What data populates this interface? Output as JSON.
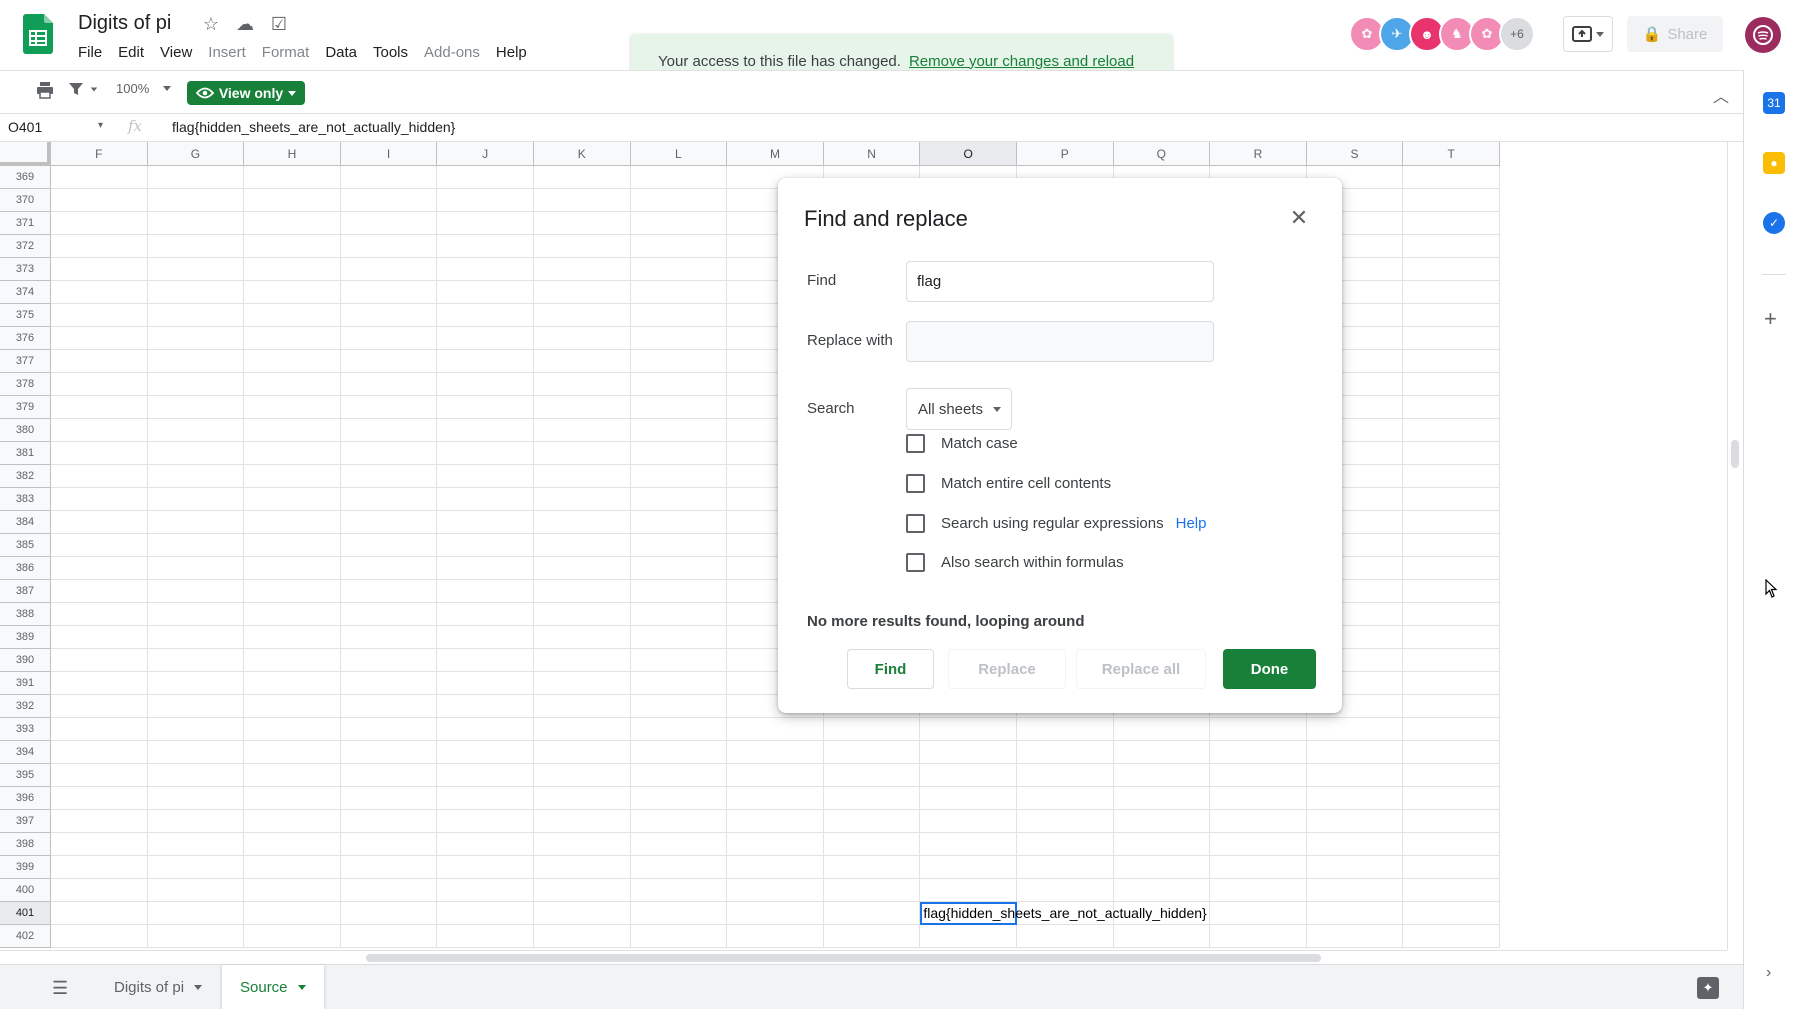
{
  "app": {
    "doc_title": "Digits of pi",
    "brand_color": "#188038",
    "menu": [
      {
        "label": "File",
        "disabled": false
      },
      {
        "label": "Edit",
        "disabled": false
      },
      {
        "label": "View",
        "disabled": false
      },
      {
        "label": "Insert",
        "disabled": true
      },
      {
        "label": "Format",
        "disabled": true
      },
      {
        "label": "Data",
        "disabled": false
      },
      {
        "label": "Tools",
        "disabled": false
      },
      {
        "label": "Add-ons",
        "disabled": true
      },
      {
        "label": "Help",
        "disabled": false
      }
    ],
    "collaborators_more": "+6",
    "collaborator_colors": [
      "#f28bb5",
      "#4ea6e8",
      "#e8336d",
      "#f28bb5",
      "#f28bb5"
    ],
    "share_label": "Share",
    "account_color": "#9c2b5e"
  },
  "toast": {
    "message": "Your access to this file has changed.",
    "link": "Remove your changes and reload"
  },
  "toolbar": {
    "zoom": "100%",
    "view_only_label": "View only"
  },
  "formula_bar": {
    "cell_ref": "O401",
    "formula": "flag{hidden_sheets_are_not_actually_hidden}"
  },
  "grid": {
    "columns": [
      "F",
      "G",
      "H",
      "I",
      "J",
      "K",
      "L",
      "M",
      "N",
      "O",
      "P",
      "Q",
      "R",
      "S",
      "T"
    ],
    "selected_column": "O",
    "row_start": 369,
    "row_end": 402,
    "selected_row": 401,
    "active_cell_text": "flag{hidden_sheets_are_not_actually_hidden}"
  },
  "sheets": {
    "tabs": [
      {
        "label": "Digits of pi",
        "active": false
      },
      {
        "label": "Source",
        "active": true
      }
    ]
  },
  "dialog": {
    "title": "Find and replace",
    "find_label": "Find",
    "find_value": "flag",
    "replace_label": "Replace with",
    "replace_value": "",
    "search_label": "Search",
    "search_scope": "All sheets",
    "options": [
      {
        "label": "Match case",
        "checked": false
      },
      {
        "label": "Match entire cell contents",
        "checked": false
      },
      {
        "label": "Search using regular expressions",
        "checked": false
      },
      {
        "label": "Also search within formulas",
        "checked": false
      }
    ],
    "help_link": "Help",
    "status": "No more results found, looping around",
    "buttons": {
      "find": "Find",
      "replace": "Replace",
      "replace_all": "Replace all",
      "done": "Done"
    }
  }
}
